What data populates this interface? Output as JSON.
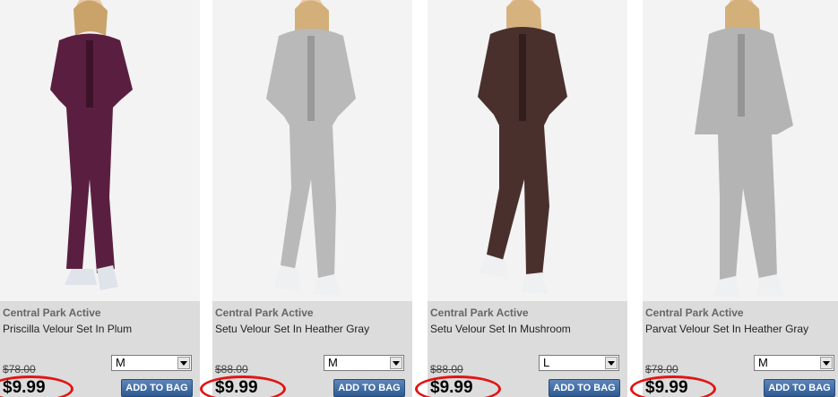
{
  "products": [
    {
      "brand": "Central Park Active",
      "name": "Priscilla Velour Set In Plum",
      "size_selected": "M",
      "original_price": "$78.00",
      "sale_price": "$9.99",
      "add_label": "ADD TO BAG",
      "suit_color": "#5a1f40",
      "suit_shade": "#3e1229"
    },
    {
      "brand": "Central Park Active",
      "name": "Setu Velour Set In Heather Gray",
      "size_selected": "M",
      "original_price": "$88.00",
      "sale_price": "$9.99",
      "add_label": "ADD TO BAG",
      "suit_color": "#b9b9b9",
      "suit_shade": "#999999"
    },
    {
      "brand": "Central Park Active",
      "name": "Setu Velour Set In Mushroom",
      "size_selected": "L",
      "original_price": "$88.00",
      "sale_price": "$9.99",
      "add_label": "ADD TO BAG",
      "suit_color": "#4a302d",
      "suit_shade": "#321f1d"
    },
    {
      "brand": "Central Park Active",
      "name": "Parvat Velour Set In Heather Gray",
      "size_selected": "M",
      "original_price": "$78.00",
      "sale_price": "$9.99",
      "add_label": "ADD TO BAG",
      "suit_color": "#b4b4b4",
      "suit_shade": "#959595"
    }
  ],
  "colors": {
    "info_panel": "#dcdcdc",
    "price_ring": "#e11515",
    "button": "#2d5a94"
  },
  "icons": {
    "select_arrow": "chevron-down-icon"
  }
}
